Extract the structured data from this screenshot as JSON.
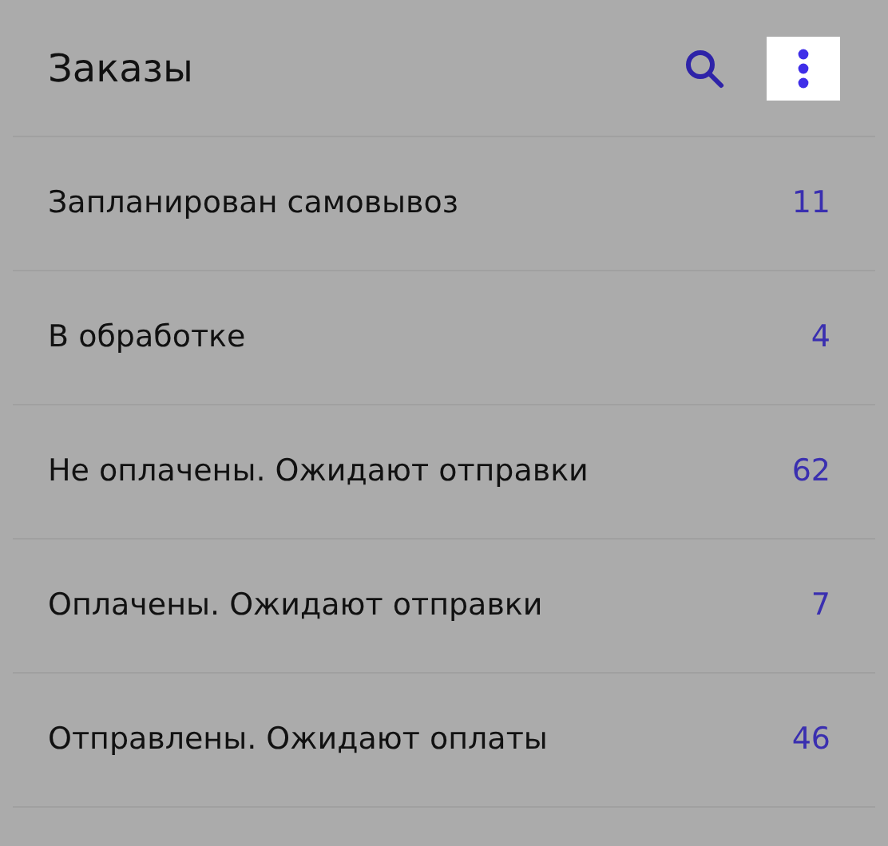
{
  "header": {
    "title": "Заказы",
    "actions": [
      {
        "kind": "search",
        "pressed": false
      },
      {
        "kind": "menu",
        "pressed": true
      }
    ]
  },
  "orders": [
    {
      "label": "Запланирован самовывоз",
      "count": "11"
    },
    {
      "label": "В обработке",
      "count": "4"
    },
    {
      "label": "Не оплачены. Ожидают отправки",
      "count": "62"
    },
    {
      "label": "Оплачены. Ожидают отправки",
      "count": "7"
    },
    {
      "label": "Отправлены. Ожидают оплаты",
      "count": "46"
    }
  ]
}
